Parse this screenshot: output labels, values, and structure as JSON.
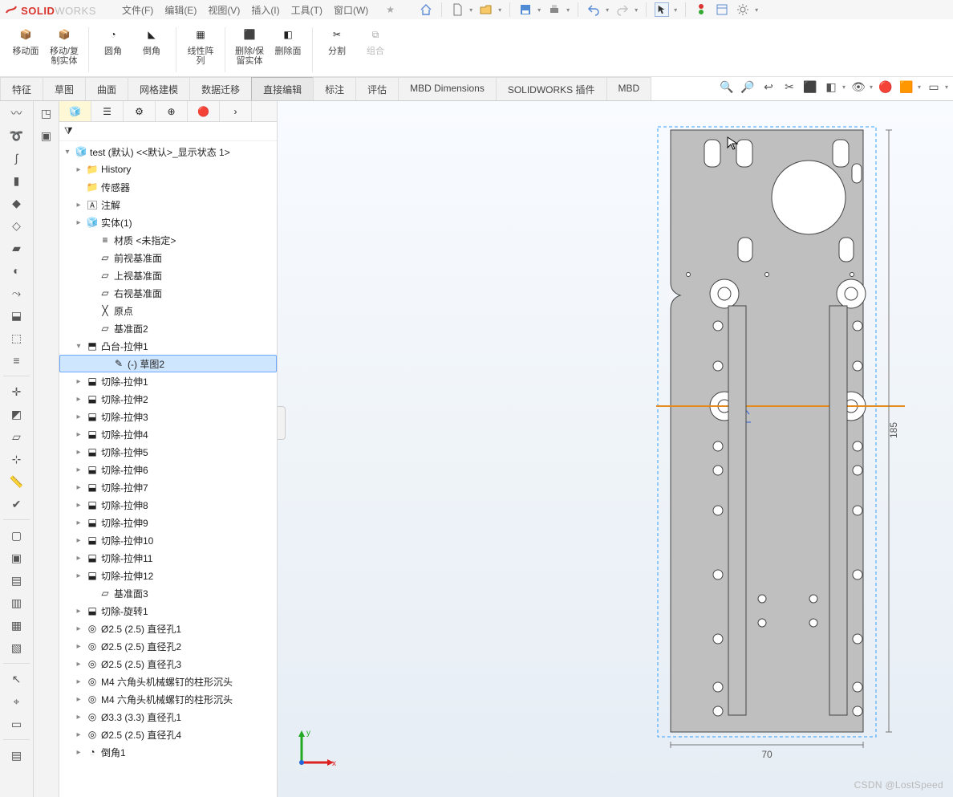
{
  "app": {
    "logo1": "SOLID",
    "logo2": "WORKS"
  },
  "menu": [
    "文件(F)",
    "编辑(E)",
    "视图(V)",
    "插入(I)",
    "工具(T)",
    "窗口(W)"
  ],
  "ribbon": [
    {
      "label": "移动面"
    },
    {
      "label": "移动/复制实体"
    },
    {
      "label": "圆角"
    },
    {
      "label": "倒角"
    },
    {
      "label": "线性阵列"
    },
    {
      "label": "删除/保留实体"
    },
    {
      "label": "删除面"
    },
    {
      "label": "分割"
    },
    {
      "label": "组合",
      "disabled": true
    }
  ],
  "tabs": [
    "特征",
    "草图",
    "曲面",
    "网格建模",
    "数据迁移",
    "直接编辑",
    "标注",
    "评估",
    "MBD Dimensions",
    "SOLIDWORKS 插件",
    "MBD"
  ],
  "activeTab": 5,
  "tree": {
    "root": "test (默认) <<默认>_显示状态 1>",
    "items": [
      {
        "l": 1,
        "exp": "▸",
        "icon": "folder",
        "label": "History"
      },
      {
        "l": 1,
        "exp": "",
        "icon": "folder",
        "label": "传感器"
      },
      {
        "l": 1,
        "exp": "▸",
        "icon": "note",
        "label": "注解"
      },
      {
        "l": 1,
        "exp": "▸",
        "icon": "cube",
        "label": "实体(1)"
      },
      {
        "l": 2,
        "exp": "",
        "icon": "mat",
        "label": "材质 <未指定>"
      },
      {
        "l": 2,
        "exp": "",
        "icon": "plane",
        "label": "前视基准面"
      },
      {
        "l": 2,
        "exp": "",
        "icon": "plane",
        "label": "上视基准面"
      },
      {
        "l": 2,
        "exp": "",
        "icon": "plane",
        "label": "右视基准面"
      },
      {
        "l": 2,
        "exp": "",
        "icon": "origin",
        "label": "原点"
      },
      {
        "l": 2,
        "exp": "",
        "icon": "plane",
        "label": "基准面2"
      },
      {
        "l": 1,
        "exp": "▾",
        "icon": "extrude",
        "label": "凸台-拉伸1"
      },
      {
        "l": 3,
        "exp": "",
        "icon": "sketch",
        "label": "(-) 草图2",
        "sel": true
      },
      {
        "l": 1,
        "exp": "▸",
        "icon": "cut",
        "label": "切除-拉伸1"
      },
      {
        "l": 1,
        "exp": "▸",
        "icon": "cut",
        "label": "切除-拉伸2"
      },
      {
        "l": 1,
        "exp": "▸",
        "icon": "cut",
        "label": "切除-拉伸3"
      },
      {
        "l": 1,
        "exp": "▸",
        "icon": "cut",
        "label": "切除-拉伸4"
      },
      {
        "l": 1,
        "exp": "▸",
        "icon": "cut",
        "label": "切除-拉伸5"
      },
      {
        "l": 1,
        "exp": "▸",
        "icon": "cut",
        "label": "切除-拉伸6"
      },
      {
        "l": 1,
        "exp": "▸",
        "icon": "cut",
        "label": "切除-拉伸7"
      },
      {
        "l": 1,
        "exp": "▸",
        "icon": "cut",
        "label": "切除-拉伸8"
      },
      {
        "l": 1,
        "exp": "▸",
        "icon": "cut",
        "label": "切除-拉伸9"
      },
      {
        "l": 1,
        "exp": "▸",
        "icon": "cut",
        "label": "切除-拉伸10"
      },
      {
        "l": 1,
        "exp": "▸",
        "icon": "cut",
        "label": "切除-拉伸11"
      },
      {
        "l": 1,
        "exp": "▸",
        "icon": "cut",
        "label": "切除-拉伸12"
      },
      {
        "l": 2,
        "exp": "",
        "icon": "plane",
        "label": "基准面3"
      },
      {
        "l": 1,
        "exp": "▸",
        "icon": "cut",
        "label": "切除-旋转1"
      },
      {
        "l": 1,
        "exp": "▸",
        "icon": "hole",
        "label": "Ø2.5 (2.5) 直径孔1"
      },
      {
        "l": 1,
        "exp": "▸",
        "icon": "hole",
        "label": "Ø2.5 (2.5) 直径孔2"
      },
      {
        "l": 1,
        "exp": "▸",
        "icon": "hole",
        "label": "Ø2.5 (2.5) 直径孔3"
      },
      {
        "l": 1,
        "exp": "▸",
        "icon": "hole",
        "label": "M4 六角头机械螺钉的柱形沉头"
      },
      {
        "l": 1,
        "exp": "▸",
        "icon": "hole",
        "label": "M4 六角头机械螺钉的柱形沉头"
      },
      {
        "l": 1,
        "exp": "▸",
        "icon": "hole",
        "label": "Ø3.3 (3.3) 直径孔1"
      },
      {
        "l": 1,
        "exp": "▸",
        "icon": "hole",
        "label": "Ø2.5 (2.5) 直径孔4"
      },
      {
        "l": 1,
        "exp": "▸",
        "icon": "fillet",
        "label": "倒角1"
      }
    ]
  },
  "dims": {
    "w": "70",
    "h": "185"
  },
  "triad": {
    "x": "x",
    "y": "y"
  },
  "watermark": "CSDN @LostSpeed"
}
